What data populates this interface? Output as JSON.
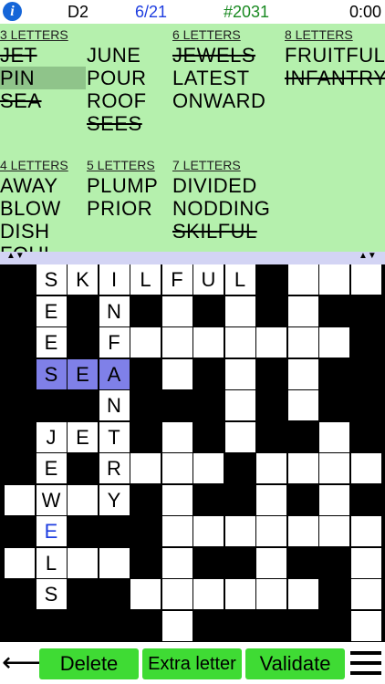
{
  "header": {
    "info_icon": "i",
    "level": "D2",
    "progress": "6/21",
    "puzzle_number": "#2031",
    "timer": "0:00"
  },
  "word_list": {
    "columns": [
      {
        "groups": [
          {
            "header": "3 LETTERS",
            "words": [
              {
                "text": "JET",
                "found": true,
                "selected": false
              },
              {
                "text": "PIN",
                "found": false,
                "selected": true
              },
              {
                "text": "SEA",
                "found": true,
                "selected": false
              }
            ]
          },
          {
            "header": "4 LETTERS",
            "words": [
              {
                "text": "AWAY",
                "found": false,
                "selected": false
              },
              {
                "text": "BLOW",
                "found": false,
                "selected": false
              },
              {
                "text": "DISH",
                "found": false,
                "selected": false
              },
              {
                "text": "FOUL",
                "found": false,
                "selected": false
              }
            ]
          }
        ]
      },
      {
        "groups": [
          {
            "header": "",
            "words": [
              {
                "text": "JUNE",
                "found": false,
                "selected": false
              },
              {
                "text": "POUR",
                "found": false,
                "selected": false
              },
              {
                "text": "ROOF",
                "found": false,
                "selected": false
              },
              {
                "text": "SEES",
                "found": true,
                "selected": false
              }
            ]
          },
          {
            "header": "5 LETTERS",
            "words": [
              {
                "text": "PLUMP",
                "found": false,
                "selected": false
              },
              {
                "text": "PRIOR",
                "found": false,
                "selected": false
              }
            ]
          }
        ]
      },
      {
        "groups": [
          {
            "header": "6 LETTERS",
            "words": [
              {
                "text": "JEWELS",
                "found": true,
                "selected": false
              },
              {
                "text": "LATEST",
                "found": false,
                "selected": false
              },
              {
                "text": "ONWARD",
                "found": false,
                "selected": false
              }
            ]
          },
          {
            "header": "7 LETTERS",
            "words": [
              {
                "text": "DIVIDED",
                "found": false,
                "selected": false
              },
              {
                "text": "NODDING",
                "found": false,
                "selected": false
              },
              {
                "text": "SKILFUL",
                "found": true,
                "selected": false
              }
            ]
          }
        ]
      },
      {
        "groups": [
          {
            "header": "8 LETTERS",
            "words": [
              {
                "text": "FRUITFUL",
                "found": false,
                "selected": false
              },
              {
                "text": "INFANTRY",
                "found": true,
                "selected": false
              }
            ]
          }
        ]
      }
    ]
  },
  "grid": {
    "cols": 12,
    "rows": 12,
    "cells": [
      {
        "r": 0,
        "c": 1,
        "ch": "S"
      },
      {
        "r": 0,
        "c": 2,
        "ch": "K"
      },
      {
        "r": 0,
        "c": 3,
        "ch": "I"
      },
      {
        "r": 0,
        "c": 4,
        "ch": "L"
      },
      {
        "r": 0,
        "c": 5,
        "ch": "F"
      },
      {
        "r": 0,
        "c": 6,
        "ch": "U"
      },
      {
        "r": 0,
        "c": 7,
        "ch": "L"
      },
      {
        "r": 0,
        "c": 9,
        "ch": ""
      },
      {
        "r": 0,
        "c": 10,
        "ch": ""
      },
      {
        "r": 0,
        "c": 11,
        "ch": ""
      },
      {
        "r": 1,
        "c": 1,
        "ch": "E"
      },
      {
        "r": 1,
        "c": 3,
        "ch": "N"
      },
      {
        "r": 1,
        "c": 5,
        "ch": ""
      },
      {
        "r": 1,
        "c": 7,
        "ch": ""
      },
      {
        "r": 1,
        "c": 9,
        "ch": ""
      },
      {
        "r": 2,
        "c": 1,
        "ch": "E"
      },
      {
        "r": 2,
        "c": 3,
        "ch": "F"
      },
      {
        "r": 2,
        "c": 4,
        "ch": ""
      },
      {
        "r": 2,
        "c": 5,
        "ch": ""
      },
      {
        "r": 2,
        "c": 6,
        "ch": ""
      },
      {
        "r": 2,
        "c": 7,
        "ch": ""
      },
      {
        "r": 2,
        "c": 8,
        "ch": ""
      },
      {
        "r": 2,
        "c": 9,
        "ch": ""
      },
      {
        "r": 2,
        "c": 10,
        "ch": ""
      },
      {
        "r": 3,
        "c": 1,
        "ch": "S",
        "hl": true
      },
      {
        "r": 3,
        "c": 2,
        "ch": "E",
        "hl": true
      },
      {
        "r": 3,
        "c": 3,
        "ch": "A",
        "hl": true
      },
      {
        "r": 3,
        "c": 5,
        "ch": ""
      },
      {
        "r": 3,
        "c": 7,
        "ch": ""
      },
      {
        "r": 3,
        "c": 9,
        "ch": ""
      },
      {
        "r": 4,
        "c": 3,
        "ch": "N"
      },
      {
        "r": 4,
        "c": 7,
        "ch": ""
      },
      {
        "r": 4,
        "c": 9,
        "ch": ""
      },
      {
        "r": 5,
        "c": 1,
        "ch": "J"
      },
      {
        "r": 5,
        "c": 2,
        "ch": "E"
      },
      {
        "r": 5,
        "c": 3,
        "ch": "T"
      },
      {
        "r": 5,
        "c": 5,
        "ch": ""
      },
      {
        "r": 5,
        "c": 7,
        "ch": ""
      },
      {
        "r": 5,
        "c": 10,
        "ch": ""
      },
      {
        "r": 6,
        "c": 1,
        "ch": "E"
      },
      {
        "r": 6,
        "c": 3,
        "ch": "R"
      },
      {
        "r": 6,
        "c": 4,
        "ch": ""
      },
      {
        "r": 6,
        "c": 5,
        "ch": ""
      },
      {
        "r": 6,
        "c": 6,
        "ch": ""
      },
      {
        "r": 6,
        "c": 8,
        "ch": ""
      },
      {
        "r": 6,
        "c": 9,
        "ch": ""
      },
      {
        "r": 6,
        "c": 10,
        "ch": ""
      },
      {
        "r": 6,
        "c": 11,
        "ch": ""
      },
      {
        "r": 7,
        "c": 0,
        "ch": ""
      },
      {
        "r": 7,
        "c": 1,
        "ch": "W"
      },
      {
        "r": 7,
        "c": 2,
        "ch": ""
      },
      {
        "r": 7,
        "c": 3,
        "ch": "Y"
      },
      {
        "r": 7,
        "c": 5,
        "ch": ""
      },
      {
        "r": 7,
        "c": 8,
        "ch": ""
      },
      {
        "r": 7,
        "c": 10,
        "ch": ""
      },
      {
        "r": 8,
        "c": 1,
        "ch": "E",
        "blue": true
      },
      {
        "r": 8,
        "c": 5,
        "ch": ""
      },
      {
        "r": 8,
        "c": 6,
        "ch": ""
      },
      {
        "r": 8,
        "c": 7,
        "ch": ""
      },
      {
        "r": 8,
        "c": 8,
        "ch": ""
      },
      {
        "r": 8,
        "c": 9,
        "ch": ""
      },
      {
        "r": 8,
        "c": 10,
        "ch": ""
      },
      {
        "r": 8,
        "c": 11,
        "ch": ""
      },
      {
        "r": 9,
        "c": 0,
        "ch": ""
      },
      {
        "r": 9,
        "c": 1,
        "ch": "L"
      },
      {
        "r": 9,
        "c": 2,
        "ch": ""
      },
      {
        "r": 9,
        "c": 3,
        "ch": ""
      },
      {
        "r": 9,
        "c": 5,
        "ch": ""
      },
      {
        "r": 9,
        "c": 8,
        "ch": ""
      },
      {
        "r": 9,
        "c": 11,
        "ch": ""
      },
      {
        "r": 10,
        "c": 1,
        "ch": "S"
      },
      {
        "r": 10,
        "c": 4,
        "ch": ""
      },
      {
        "r": 10,
        "c": 5,
        "ch": ""
      },
      {
        "r": 10,
        "c": 6,
        "ch": ""
      },
      {
        "r": 10,
        "c": 7,
        "ch": ""
      },
      {
        "r": 10,
        "c": 8,
        "ch": ""
      },
      {
        "r": 10,
        "c": 9,
        "ch": ""
      },
      {
        "r": 10,
        "c": 11,
        "ch": ""
      },
      {
        "r": 11,
        "c": 5,
        "ch": ""
      },
      {
        "r": 11,
        "c": 11,
        "ch": ""
      }
    ]
  },
  "toolbar": {
    "back_arrow": "🡐",
    "delete_label": "Delete",
    "extra_letter_label": "Extra letter",
    "validate_label": "Validate"
  },
  "colors": {
    "panel_bg": "#b5f0ad",
    "button_green": "#3fdb34",
    "highlight": "#7f80e8",
    "separator": "#d3d4f4"
  }
}
